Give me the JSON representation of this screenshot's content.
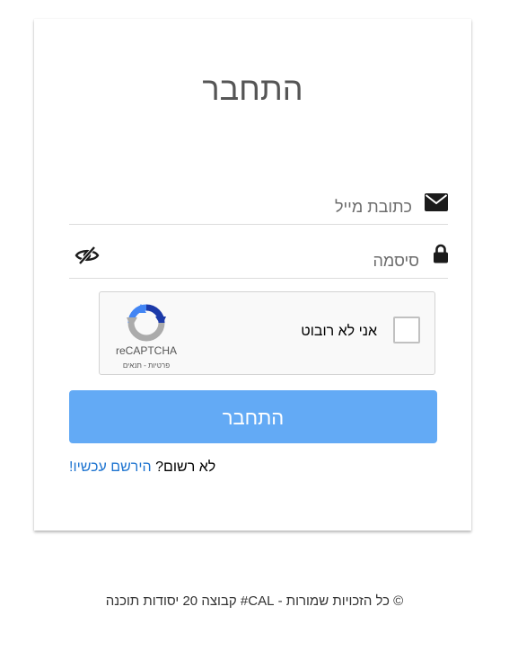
{
  "login": {
    "title": "התחבר",
    "email_placeholder": "כתובת מייל",
    "password_placeholder": "סיסמה",
    "submit_label": "התחבר",
    "register_prompt": "לא רשום?",
    "register_link": "הירשם עכשיו!"
  },
  "captcha": {
    "checkbox_label": "אני לא רובוט",
    "brand": "reCAPTCHA",
    "terms": "פרטיות - תנאים"
  },
  "footer": {
    "text": "© כל הזכויות שמורות - CAL# קבוצה 20 יסודות תוכנה"
  },
  "icons": {
    "email": "envelope-icon",
    "password": "lock-icon",
    "toggle_visibility": "eye-slash-icon",
    "captcha_logo": "recaptcha-logo-icon"
  },
  "colors": {
    "button": "#63aaf5",
    "link": "#1e74d0",
    "title": "#555555"
  }
}
